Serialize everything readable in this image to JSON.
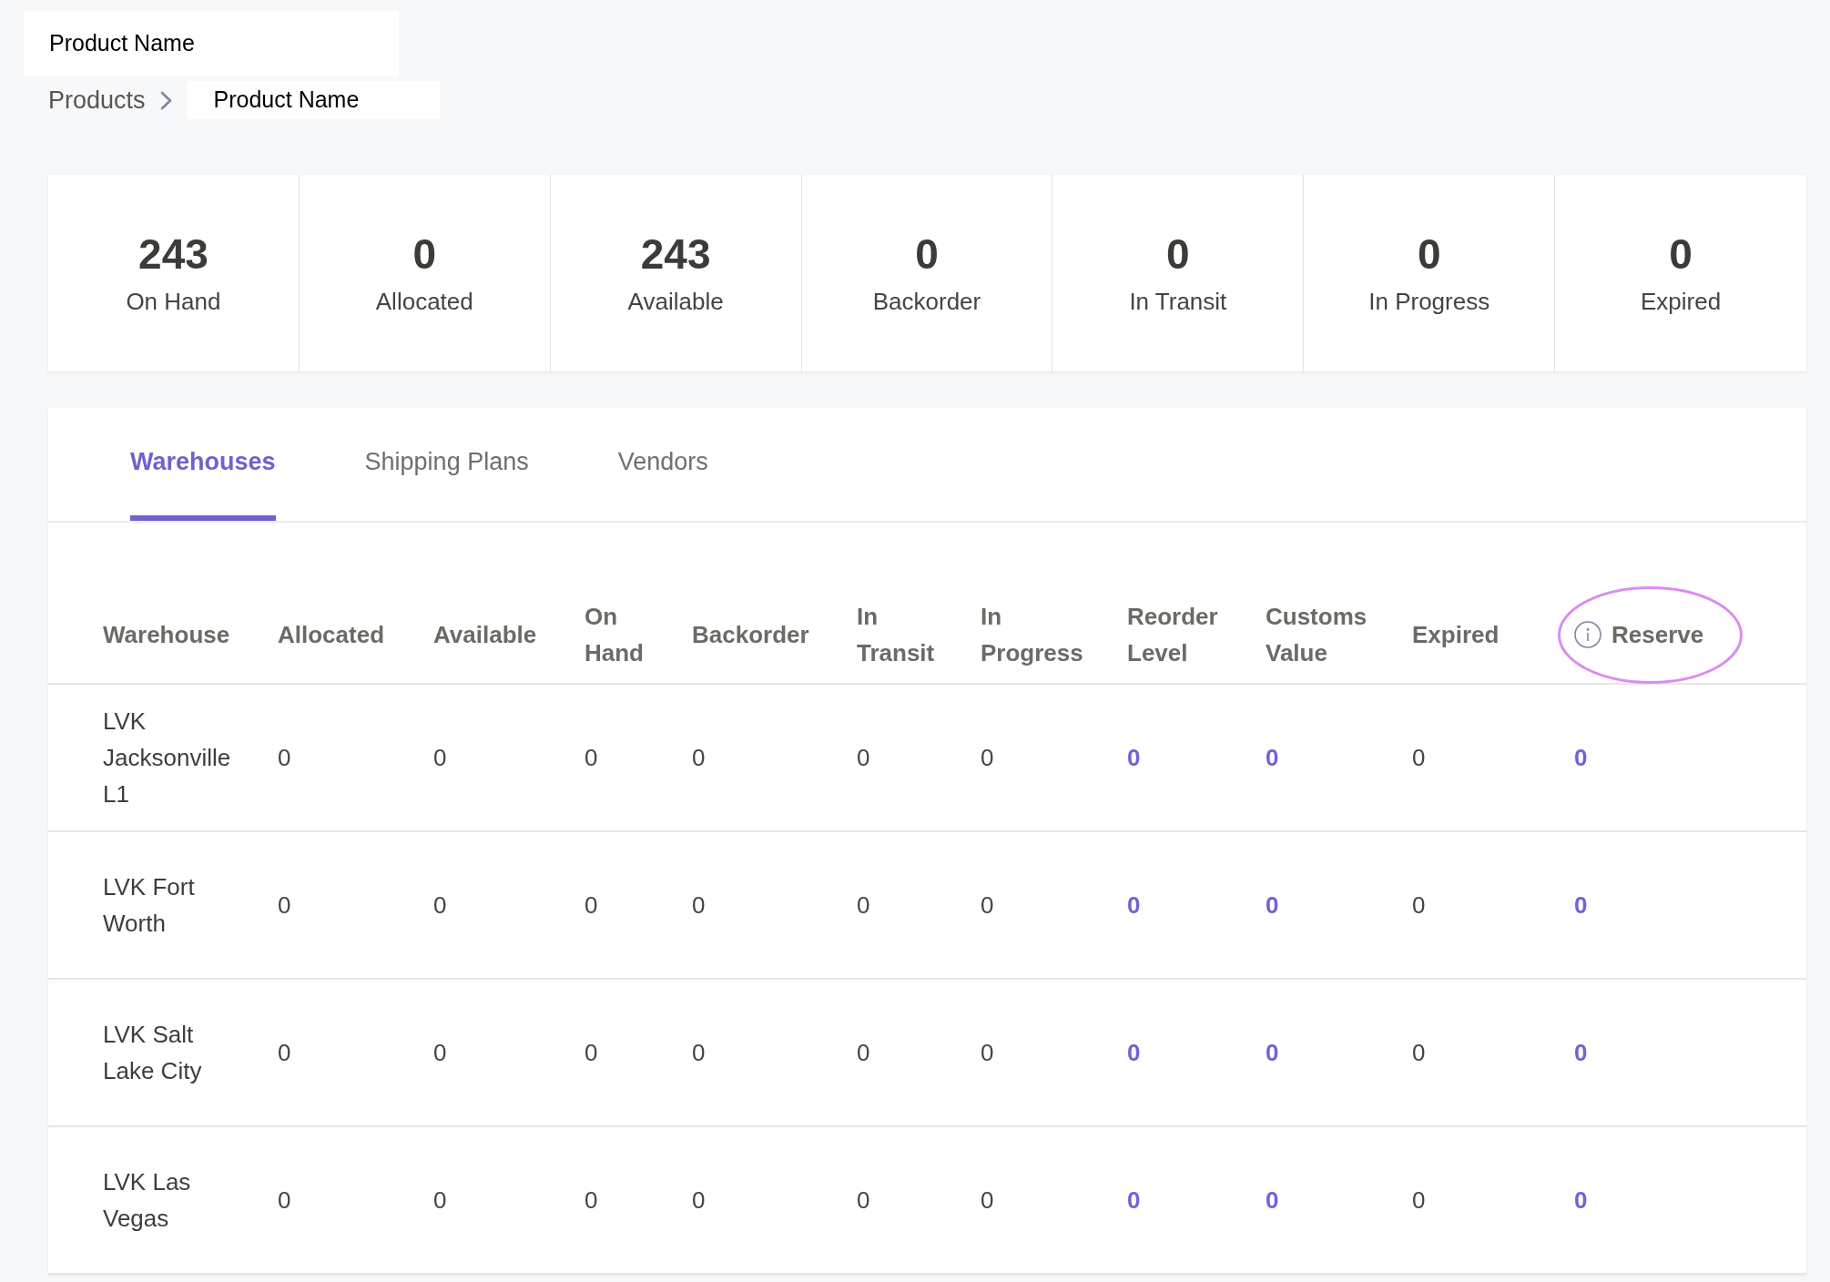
{
  "page_title": "Product Name",
  "breadcrumb": [
    {
      "label": "Products",
      "current": false
    },
    {
      "label": "Product Name",
      "current": true
    }
  ],
  "stats": [
    {
      "value": "243",
      "label": "On Hand"
    },
    {
      "value": "0",
      "label": "Allocated"
    },
    {
      "value": "243",
      "label": "Available"
    },
    {
      "value": "0",
      "label": "Backorder"
    },
    {
      "value": "0",
      "label": "In Transit"
    },
    {
      "value": "0",
      "label": "In Progress"
    },
    {
      "value": "0",
      "label": "Expired"
    }
  ],
  "tabs": [
    {
      "label": "Warehouses",
      "selected": true
    },
    {
      "label": "Shipping Plans",
      "selected": false
    },
    {
      "label": "Vendors",
      "selected": false
    }
  ],
  "table": {
    "columns": [
      {
        "label": "Warehouse",
        "kind": "name",
        "info": false,
        "highlighted": false
      },
      {
        "label": "Allocated",
        "kind": "number",
        "info": false,
        "highlighted": false
      },
      {
        "label": "Available",
        "kind": "number",
        "info": false,
        "highlighted": false
      },
      {
        "label": "On Hand",
        "kind": "number",
        "info": false,
        "highlighted": false
      },
      {
        "label": "Backorder",
        "kind": "number",
        "info": false,
        "highlighted": false
      },
      {
        "label": "In Transit",
        "kind": "number",
        "info": false,
        "highlighted": false
      },
      {
        "label": "In Progress",
        "kind": "number",
        "info": false,
        "highlighted": false
      },
      {
        "label": "Reorder Level",
        "kind": "link",
        "info": false,
        "highlighted": false
      },
      {
        "label": "Customs Value",
        "kind": "link",
        "info": false,
        "highlighted": false
      },
      {
        "label": "Expired",
        "kind": "number",
        "info": false,
        "highlighted": false
      },
      {
        "label": "Reserve",
        "kind": "link",
        "info": true,
        "highlighted": true
      }
    ],
    "rows": [
      {
        "cells": [
          "LVK Jacksonville L1",
          "0",
          "0",
          "0",
          "0",
          "0",
          "0",
          "0",
          "0",
          "0",
          "0"
        ]
      },
      {
        "cells": [
          "LVK Fort Worth",
          "0",
          "0",
          "0",
          "0",
          "0",
          "0",
          "0",
          "0",
          "0",
          "0"
        ]
      },
      {
        "cells": [
          "LVK Salt Lake City",
          "0",
          "0",
          "0",
          "0",
          "0",
          "0",
          "0",
          "0",
          "0",
          "0"
        ]
      },
      {
        "cells": [
          "LVK Las Vegas",
          "0",
          "0",
          "0",
          "0",
          "0",
          "0",
          "0",
          "0",
          "0",
          "0"
        ]
      }
    ]
  }
}
